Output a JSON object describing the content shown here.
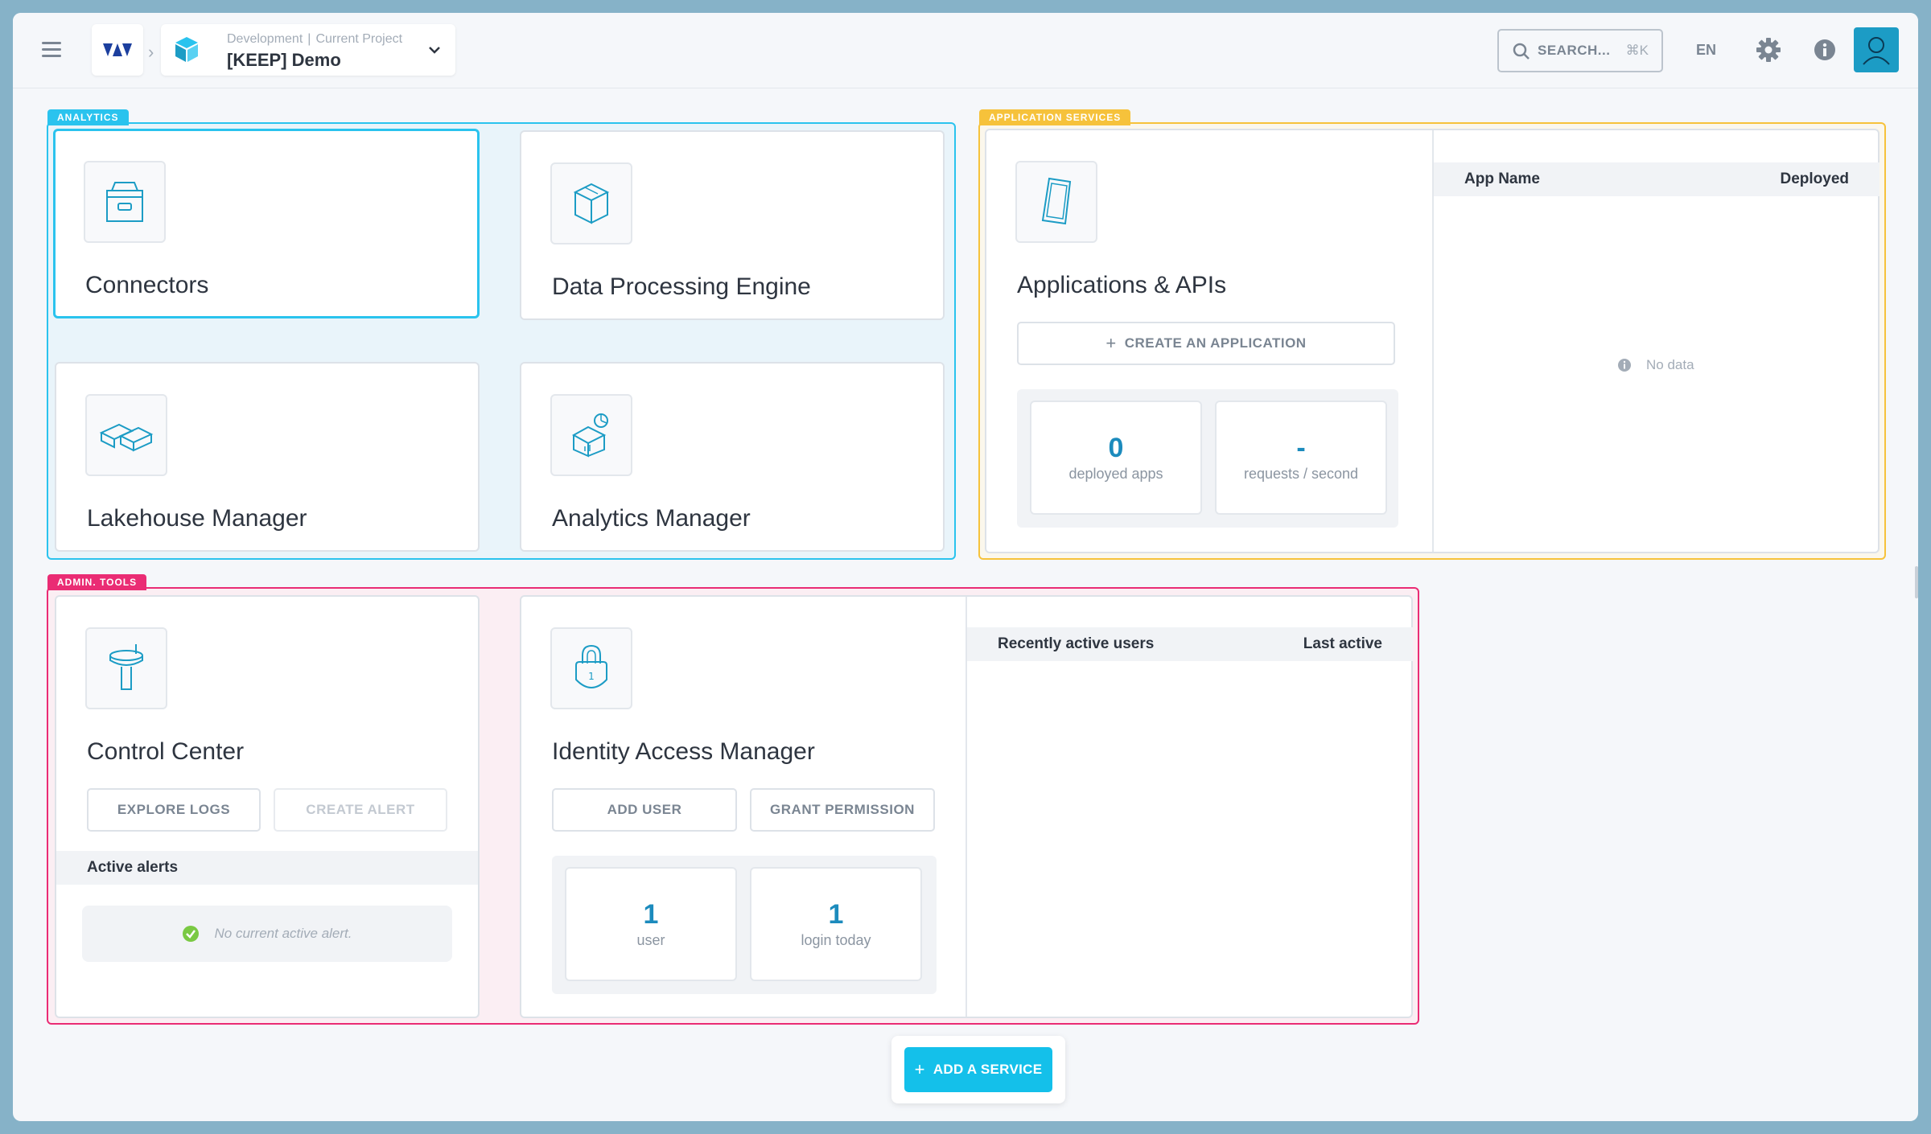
{
  "topbar": {
    "environment": "Development",
    "project_label": "Current Project",
    "project_name": "[KEEP] Demo",
    "search_placeholder": "SEARCH...",
    "search_shortcut": "⌘K",
    "language": "EN"
  },
  "analytics": {
    "tag": "ANALYTICS",
    "cards": [
      {
        "title": "Connectors"
      },
      {
        "title": "Data Processing Engine"
      },
      {
        "title": "Lakehouse Manager"
      },
      {
        "title": "Analytics Manager"
      }
    ]
  },
  "app_services": {
    "tag": "APPLICATION SERVICES",
    "title": "Applications & APIs",
    "create_button": "CREATE AN APPLICATION",
    "stats": [
      {
        "value": "0",
        "label": "deployed apps"
      },
      {
        "value": "-",
        "label": "requests / second"
      }
    ],
    "table": {
      "col1": "App Name",
      "col2": "Deployed",
      "empty": "No data"
    }
  },
  "admin": {
    "tag": "ADMIN. TOOLS",
    "control_center": {
      "title": "Control Center",
      "explore_logs": "EXPLORE LOGS",
      "create_alert": "CREATE ALERT",
      "alerts_header": "Active alerts",
      "alerts_empty": "No current active alert."
    },
    "iam": {
      "title": "Identity Access Manager",
      "add_user": "ADD USER",
      "grant_permission": "GRANT PERMISSION",
      "stats": [
        {
          "value": "1",
          "label": "user"
        },
        {
          "value": "1",
          "label": "login today"
        }
      ],
      "table": {
        "col1": "Recently active users",
        "col2": "Last active"
      }
    }
  },
  "footer": {
    "add_service": "ADD A SERVICE"
  },
  "colors": {
    "analytics": "#2ac3ee",
    "app_services": "#f6c23b",
    "admin": "#ea2c74",
    "primary": "#14c0ea"
  }
}
